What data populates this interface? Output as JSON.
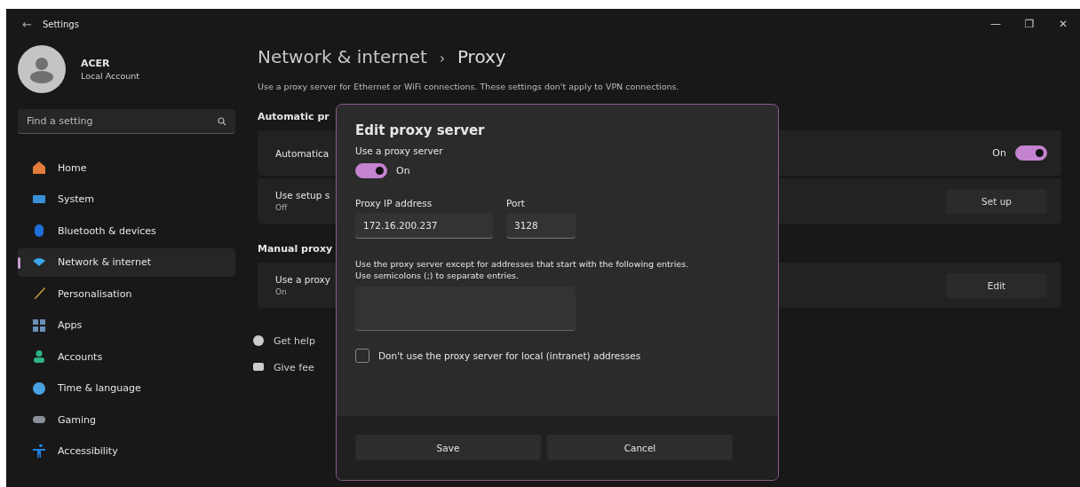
{
  "window": {
    "title": "Settings",
    "back": "←",
    "controls": [
      "—",
      "❐",
      "✕"
    ]
  },
  "account": {
    "name": "ACER",
    "type": "Local Account"
  },
  "search": {
    "placeholder": "Find a setting"
  },
  "sidebar": {
    "items": [
      {
        "label": "Home",
        "selected": false
      },
      {
        "label": "System",
        "selected": false
      },
      {
        "label": "Bluetooth & devices",
        "selected": false
      },
      {
        "label": "Network & internet",
        "selected": true
      },
      {
        "label": "Personalisation",
        "selected": false
      },
      {
        "label": "Apps",
        "selected": false
      },
      {
        "label": "Accounts",
        "selected": false
      },
      {
        "label": "Time & language",
        "selected": false
      },
      {
        "label": "Gaming",
        "selected": false
      },
      {
        "label": "Accessibility",
        "selected": false
      }
    ]
  },
  "breadcrumb": {
    "parent": "Network & internet",
    "separator": "›",
    "current": "Proxy"
  },
  "description": "Use a proxy server for Ethernet or WiFi connections. These settings don't apply to VPN connections.",
  "sections": [
    {
      "heading": "Automatic pr",
      "cards": [
        {
          "kind": "toggle",
          "title": "Automatica",
          "state_label": "On",
          "on": true
        },
        {
          "kind": "button",
          "title": "Use setup s",
          "subtitle": "Off",
          "button": "Set up"
        }
      ]
    },
    {
      "heading": "Manual proxy",
      "cards": [
        {
          "kind": "button",
          "title": "Use a proxy",
          "subtitle": "On",
          "button": "Edit"
        }
      ]
    }
  ],
  "links": [
    {
      "label": "Get help"
    },
    {
      "label": "Give fee"
    }
  ],
  "dialog": {
    "title": "Edit proxy server",
    "toggle_label": "Use a proxy server",
    "toggle_state": "On",
    "toggle_on": true,
    "ip_label": "Proxy IP address",
    "ip_value": "172.16.200.237",
    "port_label": "Port",
    "port_value": "3128",
    "exceptions_text": [
      "Use the proxy server except for addresses that start with the following entries.",
      "Use semicolons (;) to separate entries."
    ],
    "local_label": "Don't use the proxy server for local (intranet) addresses",
    "local_checked": false,
    "buttons": [
      "Save",
      "Cancel"
    ]
  }
}
